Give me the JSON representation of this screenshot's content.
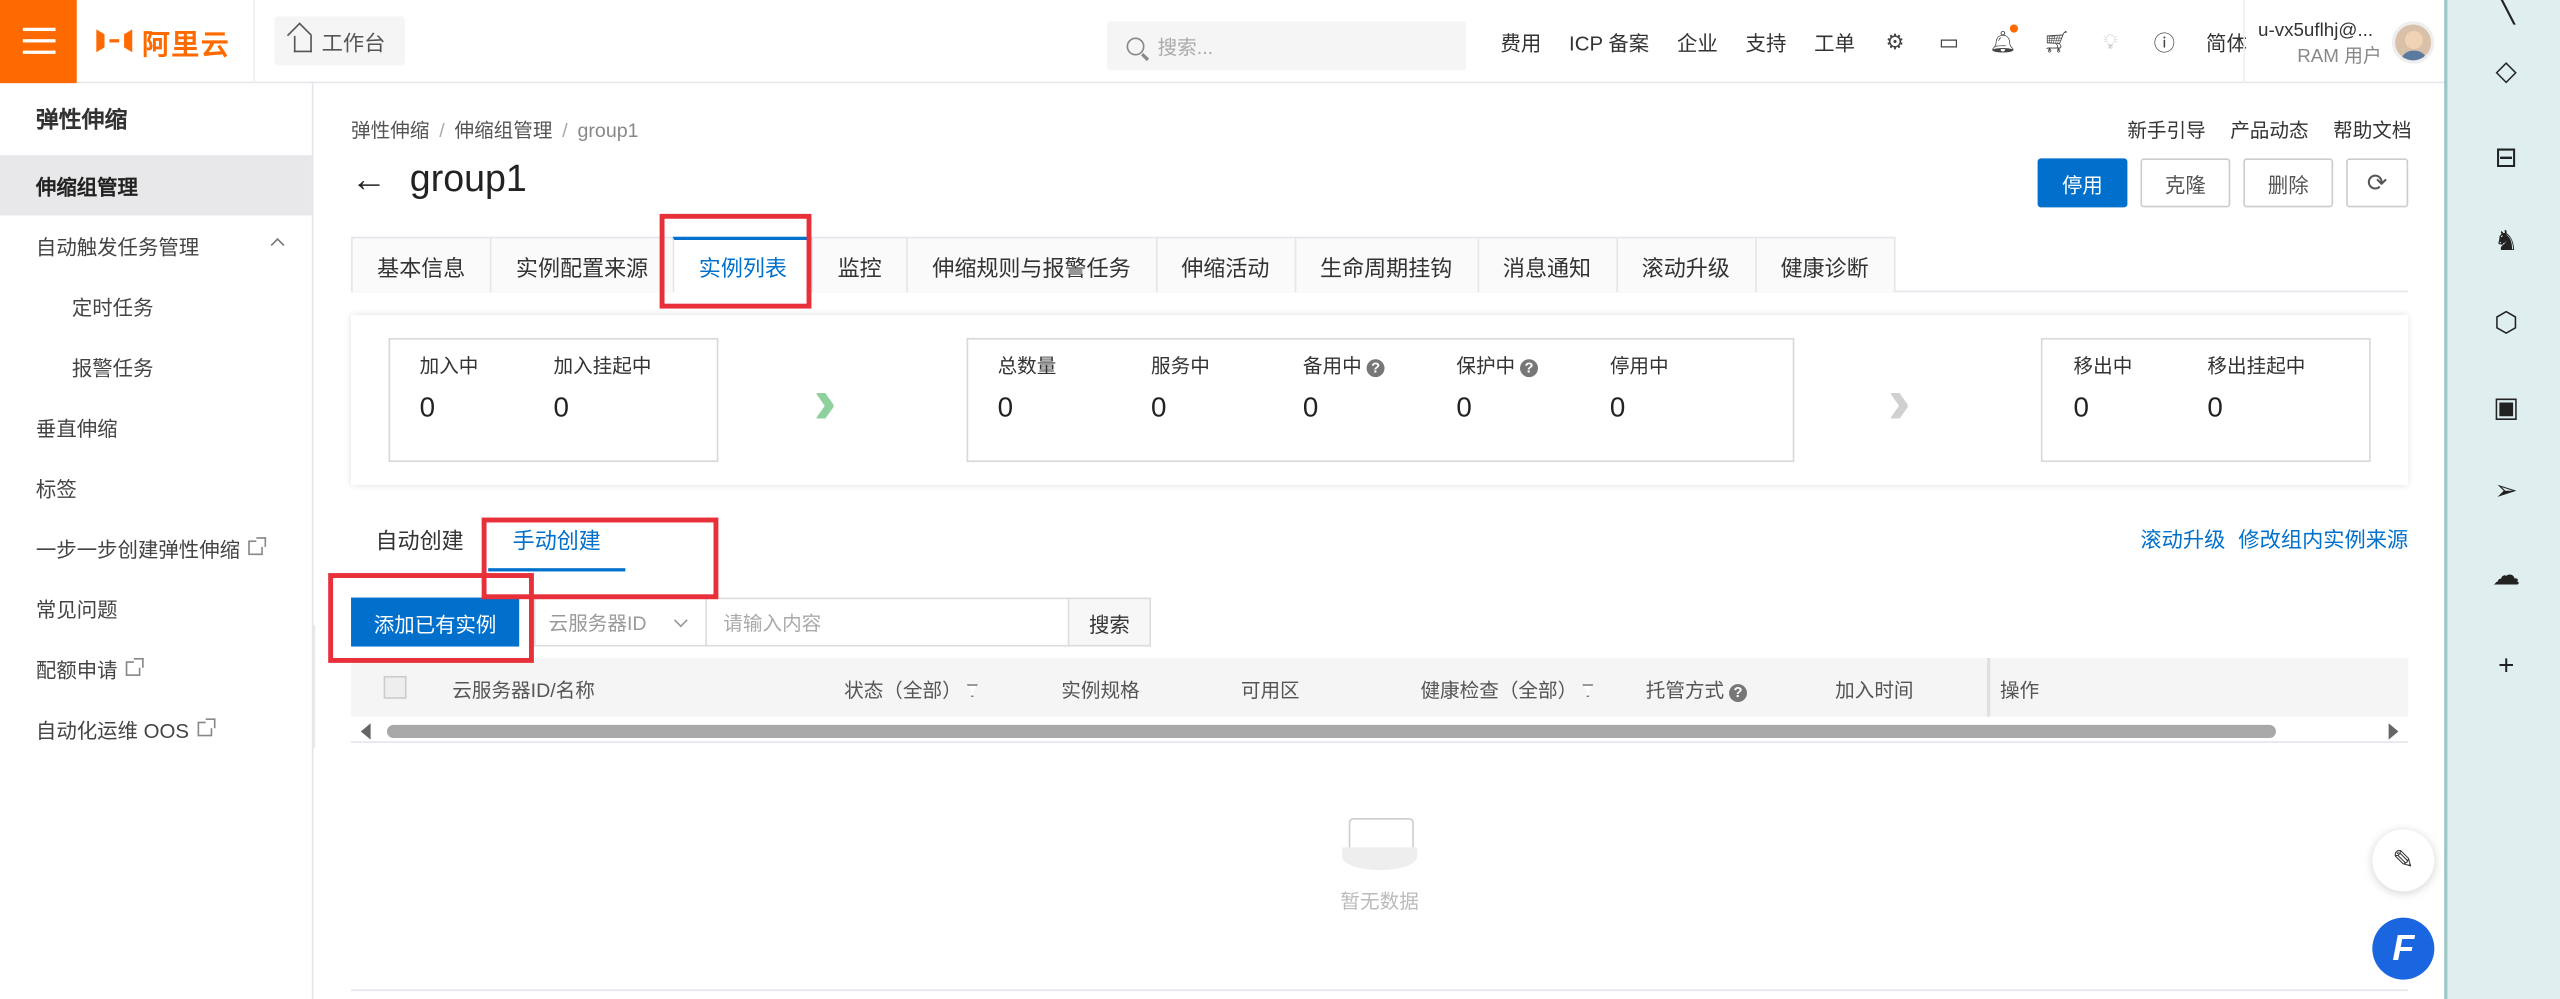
{
  "topbar": {
    "logo_text": "阿里云",
    "workbench": "工作台",
    "search_placeholder": "搜索...",
    "links": [
      "费用",
      "ICP 备案",
      "企业",
      "支持",
      "工单"
    ],
    "lang": "简体",
    "user_name": "u-vx5uflhj@...",
    "user_role": "RAM 用户"
  },
  "sidebar": {
    "title": "弹性伸缩",
    "items": [
      {
        "label": "伸缩组管理"
      },
      {
        "label": "自动触发任务管理"
      },
      {
        "label": "定时任务"
      },
      {
        "label": "报警任务"
      },
      {
        "label": "垂直伸缩"
      },
      {
        "label": "标签"
      },
      {
        "label": "一步一步创建弹性伸缩"
      },
      {
        "label": "常见问题"
      },
      {
        "label": "配额申请"
      },
      {
        "label": "自动化运维 OOS"
      }
    ]
  },
  "breadcrumb": [
    "弹性伸缩",
    "伸缩组管理",
    "group1"
  ],
  "head_links": [
    "新手引导",
    "产品动态",
    "帮助文档"
  ],
  "page": {
    "title": "group1",
    "actions": {
      "stop": "停用",
      "clone": "克隆",
      "delete": "删除"
    }
  },
  "tabs": [
    "基本信息",
    "实例配置来源",
    "实例列表",
    "监控",
    "伸缩规则与报警任务",
    "伸缩活动",
    "生命周期挂钩",
    "消息通知",
    "滚动升级",
    "健康诊断"
  ],
  "stats": {
    "joining": {
      "label": "加入中",
      "value": "0"
    },
    "joining_pending": {
      "label": "加入挂起中",
      "value": "0"
    },
    "total": {
      "label": "总数量",
      "value": "0"
    },
    "in_service": {
      "label": "服务中",
      "value": "0"
    },
    "standby": {
      "label": "备用中",
      "value": "0"
    },
    "protected": {
      "label": "保护中",
      "value": "0"
    },
    "stopped": {
      "label": "停用中",
      "value": "0"
    },
    "removing": {
      "label": "移出中",
      "value": "0"
    },
    "removing_pending": {
      "label": "移出挂起中",
      "value": "0"
    }
  },
  "subtabs": [
    "自动创建",
    "手动创建"
  ],
  "right_links": [
    "滚动升级",
    "修改组内实例来源"
  ],
  "toolbar": {
    "add_button": "添加已有实例",
    "select_value": "云服务器ID",
    "input_placeholder": "请输入内容",
    "search_button": "搜索"
  },
  "table": {
    "columns": [
      "云服务器ID/名称",
      "状态（全部）",
      "实例规格",
      "可用区",
      "健康检查（全部）",
      "托管方式",
      "加入时间",
      "操作"
    ]
  },
  "empty_text": "暂无数据",
  "colors": {
    "accent": "#0070cc",
    "brand": "#ff6a00",
    "highlight": "#e8303a"
  }
}
